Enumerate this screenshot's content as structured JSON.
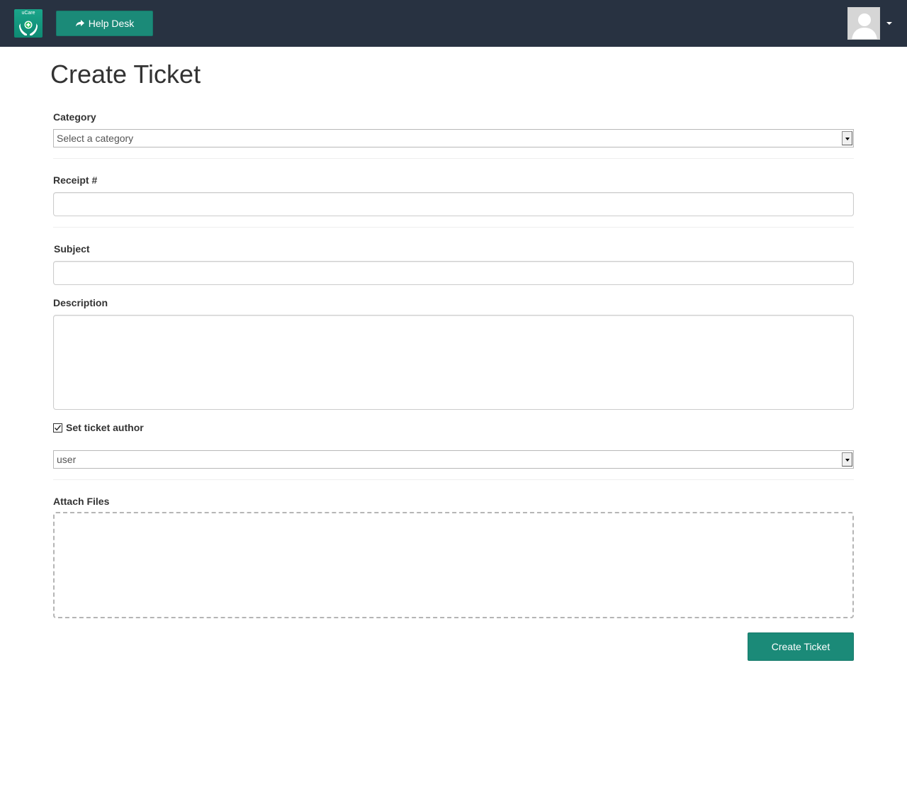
{
  "navbar": {
    "logo": {
      "name": "uCare",
      "icon": "hands-cross-logo-icon",
      "colors": {
        "bg": "#1aa58a"
      }
    },
    "helpdesk_button": {
      "label": "Help Desk",
      "icon": "share-arrow-icon"
    },
    "user_menu": {
      "avatar_icon": "user-avatar-icon",
      "caret_icon": "caret-down-icon"
    },
    "colors": {
      "bg": "#283241",
      "accent": "#1b8a78"
    }
  },
  "page": {
    "title": "Create Ticket"
  },
  "form": {
    "category": {
      "label": "Category",
      "value": "Select a category"
    },
    "receipt": {
      "label": "Receipt #",
      "value": ""
    },
    "subject": {
      "label": "Subject",
      "value": ""
    },
    "description": {
      "label": "Description",
      "value": ""
    },
    "set_author": {
      "label": "Set ticket author",
      "checked": true
    },
    "author": {
      "value": "user"
    },
    "attachments": {
      "label": "Attach Files"
    },
    "submit": {
      "label": "Create Ticket"
    }
  }
}
